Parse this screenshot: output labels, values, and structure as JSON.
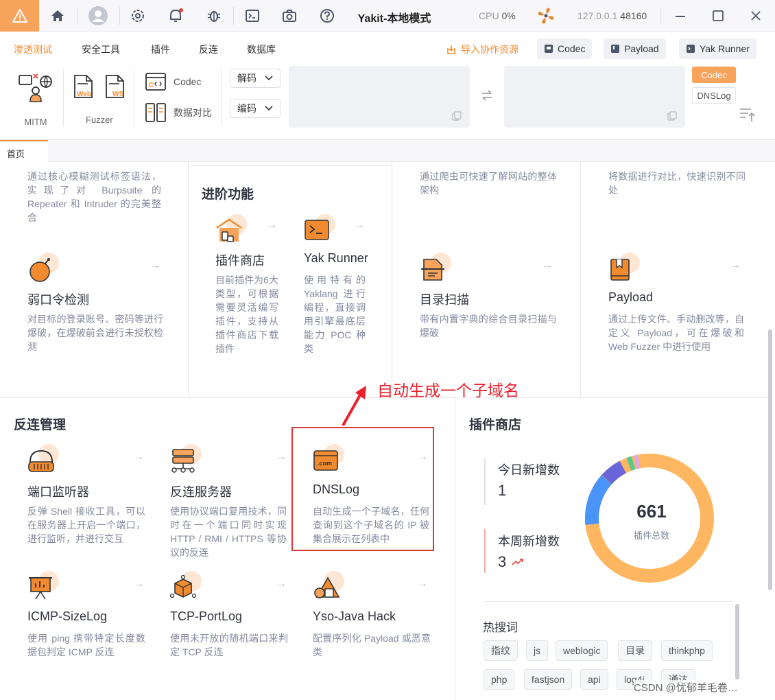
{
  "titlebar": {
    "title": "Yakit-本地模式",
    "cpu_label": "CPU",
    "cpu_value": "0%",
    "host_ip": "127.0.0.1",
    "host_port": "48160",
    "icons": [
      "warning-icon",
      "home-icon",
      "user-icon",
      "settings-icon",
      "bell-icon",
      "bug-icon",
      "terminal-icon",
      "camera-icon",
      "help-icon",
      "fan-icon"
    ],
    "window_controls": [
      "minimize",
      "maximize",
      "close"
    ]
  },
  "menu": {
    "items": [
      "渗透测试",
      "安全工具",
      "插件",
      "反连",
      "数据库"
    ],
    "active": "渗透测试",
    "import_label": "导入协作资源",
    "shortcuts": [
      "Codec",
      "Payload",
      "Yak Runner"
    ]
  },
  "toolbar": {
    "mitm_label": "MITM",
    "fuzzer_label": "Fuzzer",
    "web_label": "Web",
    "ws_label": "WS",
    "codec_label": "Codec",
    "compare_label": "数据对比",
    "decode_label": "解码",
    "encode_label": "编码",
    "codec_tag": "Codec",
    "dnslog_tag": "DNSLog"
  },
  "tabs": [
    "首页"
  ],
  "top_cards": {
    "fuzz_desc": "通过核心模糊测试标签语法，实现了对 Burpsuite 的 Repeater 和 Intruder 的完美整合",
    "crawler_desc": "通过爬虫可快速了解网站的整体架构",
    "compare_desc": "将数据进行对比，快速识别不同处",
    "advanced_title": "进阶功能",
    "plugin_store_title": "插件商店",
    "plugin_store_desc": "目前插件为6大类型，可根据需要灵活编写插件，支持从插件商店下载插件",
    "yak_runner_title": "Yak Runner",
    "yak_runner_desc": "使用特有的 Yaklang 进行编程，直接调用引擎最底层能力 POC 种类",
    "weakpass_title": "弱口令检测",
    "weakpass_desc": "对目标的登录账号、密码等进行爆破，在爆破前会进行未授权检测",
    "dirscan_title": "目录扫描",
    "dirscan_desc": "带有内置字典的综合目录扫描与爆破",
    "payload_title": "Payload",
    "payload_desc": "通过上传文件、手动删改等，自定义 Payload，可在爆破和 Web Fuzzer 中进行使用"
  },
  "reverse": {
    "title": "反连管理",
    "cards": [
      {
        "title": "端口监听器",
        "desc": "反弹 Shell 接收工具，可以在服务器上开启一个端口，进行监听，并进行交互"
      },
      {
        "title": "反连服务器",
        "desc": "使用协议端口复用技术，同时在一个端口同时实现 HTTP / RMI / HTTPS 等协议的反连"
      },
      {
        "title": "DNSLog",
        "desc": "自动生成一个子域名，任何查询到这个子域名的 IP 被集合展示在列表中"
      },
      {
        "title": "ICMP-SizeLog",
        "desc": "使用 ping 携带特定长度数据包判定 ICMP 反连"
      },
      {
        "title": "TCP-PortLog",
        "desc": "使用未开放的随机端口来判定 TCP 反连"
      },
      {
        "title": "Yso-Java Hack",
        "desc": "配置序列化 Payload 或恶意类"
      }
    ]
  },
  "plugin_panel": {
    "title": "插件商店",
    "today_label": "今日新增数",
    "today_value": "1",
    "week_label": "本周新增数",
    "week_value": "3",
    "total_value": "661",
    "total_label": "插件总数",
    "hot_label": "热搜词",
    "hot_words": [
      "指纹",
      "js",
      "weblogic",
      "目录",
      "thinkphp",
      "php",
      "fastjson",
      "api",
      "log4j",
      "通达"
    ],
    "colors": {
      "main": "#ffb660",
      "blue": "#4a94f8",
      "purple": "#6765d8",
      "green": "#56c991",
      "pink": "#d8a7f5"
    }
  },
  "annotation": {
    "text": "自动生成一个子域名"
  },
  "watermark": "CSDN @忧郁羊毛卷…"
}
